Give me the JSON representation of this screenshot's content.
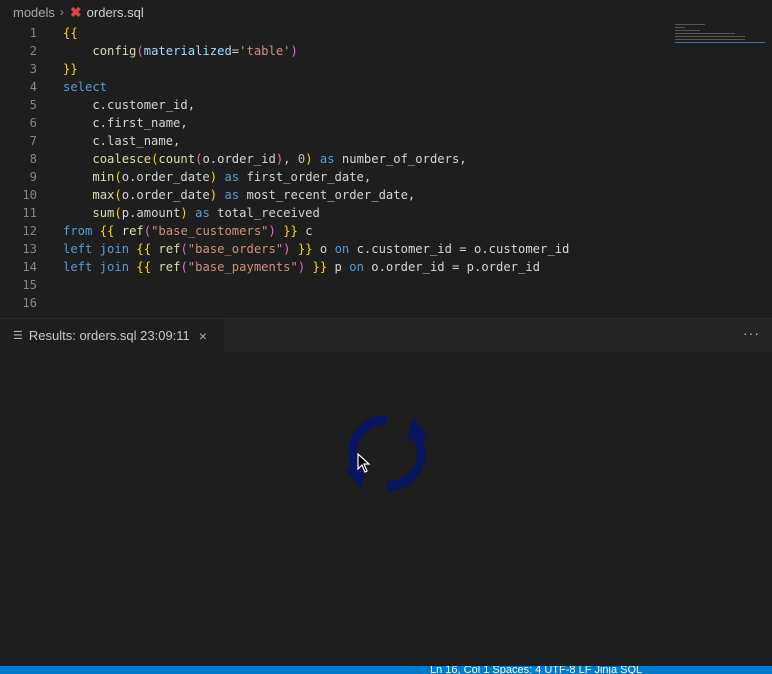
{
  "breadcrumb": {
    "folder": "models",
    "file": "orders.sql"
  },
  "editor": {
    "line_numbers": [
      "1",
      "2",
      "3",
      "4",
      "5",
      "6",
      "7",
      "8",
      "9",
      "10",
      "11",
      "12",
      "13",
      "14",
      "15",
      "16"
    ]
  },
  "results_panel": {
    "title": "Results: orders.sql 23:09:11"
  },
  "status_bar": {
    "text": "Ln 16, Col 1   Spaces: 4   UTF-8   LF   Jinja SQL"
  }
}
